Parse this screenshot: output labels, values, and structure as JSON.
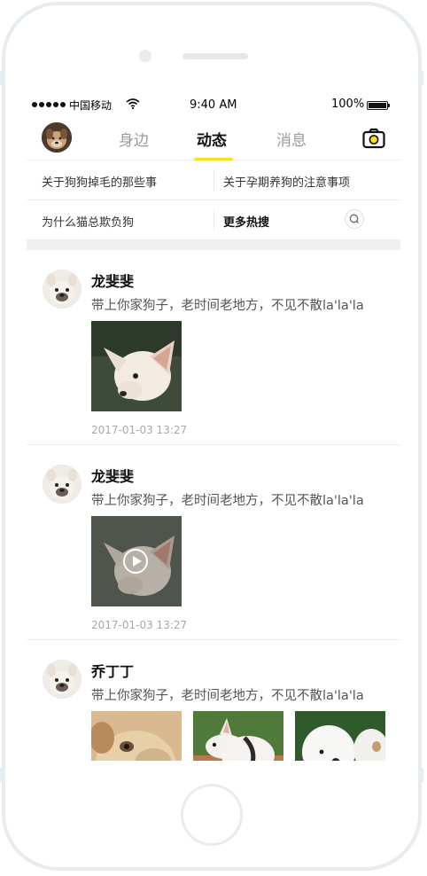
{
  "status_bar": {
    "carrier": "中国移动",
    "time": "9:40 AM",
    "battery": "100%"
  },
  "nav": {
    "tabs": [
      {
        "label": "身边",
        "active": false
      },
      {
        "label": "动态",
        "active": true
      },
      {
        "label": "消息",
        "active": false
      }
    ]
  },
  "hot_search": {
    "items": [
      "关于狗狗掉毛的那些事",
      "关于孕期养狗的注意事项",
      "为什么猫总欺负狗"
    ],
    "more_label": "更多热搜"
  },
  "feed": [
    {
      "user": "龙斐斐",
      "text": "带上你家狗子，老时间老地方，不见不散la'la'la",
      "media": "photo",
      "time": "2017-01-03 13:27"
    },
    {
      "user": "龙斐斐",
      "text": "带上你家狗子，老时间老地方，不见不散la'la'la",
      "media": "video",
      "time": "2017-01-03 13:27"
    },
    {
      "user": "乔丁丁",
      "text": "带上你家狗子，老时间老地方，不见不散la'la'la",
      "media": "photos"
    }
  ],
  "colors": {
    "accent": "#ffe016",
    "muted_text": "#9a9a9a",
    "frame": "#e6ecf0"
  }
}
